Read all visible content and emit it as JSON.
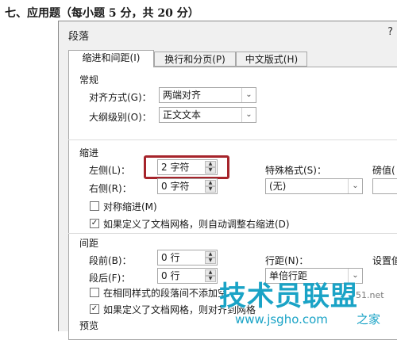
{
  "question_heading": "七、应用题（每小题 5 分，共 20 分）",
  "dialog": {
    "title": "段落",
    "help": "?",
    "tabs": [
      {
        "label": "缩进和间距(I)",
        "active": true
      },
      {
        "label": "换行和分页(P)",
        "active": false
      },
      {
        "label": "中文版式(H)",
        "active": false
      }
    ],
    "general": {
      "section": "常规",
      "alignment_label": "对齐方式(G)：",
      "alignment_value": "两端对齐",
      "outline_label": "大纲级别(O)：",
      "outline_value": "正文文本"
    },
    "indent": {
      "section": "缩进",
      "left_label": "左侧(L)：",
      "left_value": "2 字符",
      "right_label": "右侧(R)：",
      "right_value": "0 字符",
      "special_label": "特殊格式(S)：",
      "special_value": "(无)",
      "by_label": "磅值(",
      "mirror_label": "对称缩进(M)",
      "mirror_checked": false,
      "auto_adjust_label": "如果定义了文档网格，则自动调整右缩进(D)",
      "auto_adjust_checked": true
    },
    "spacing": {
      "section": "间距",
      "before_label": "段前(B)：",
      "before_value": "0 行",
      "after_label": "段后(F)：",
      "after_value": "0 行",
      "line_spacing_label": "行距(N)：",
      "line_spacing_value": "单倍行距",
      "at_label": "设置值",
      "no_space_label": "在相同样式的段落间不添加空",
      "no_space_checked": false,
      "snap_grid_label": "如果定义了文档网格，则对齐到网格",
      "snap_grid_checked": true
    },
    "preview": {
      "section": "预览"
    }
  },
  "watermark": {
    "main": "技术员联盟",
    "url": "www.jsgho.com",
    "side": "之家",
    "small": "51.net"
  },
  "colors": {
    "highlight_border": "#a6242b",
    "watermark": "#1aa3c6"
  }
}
